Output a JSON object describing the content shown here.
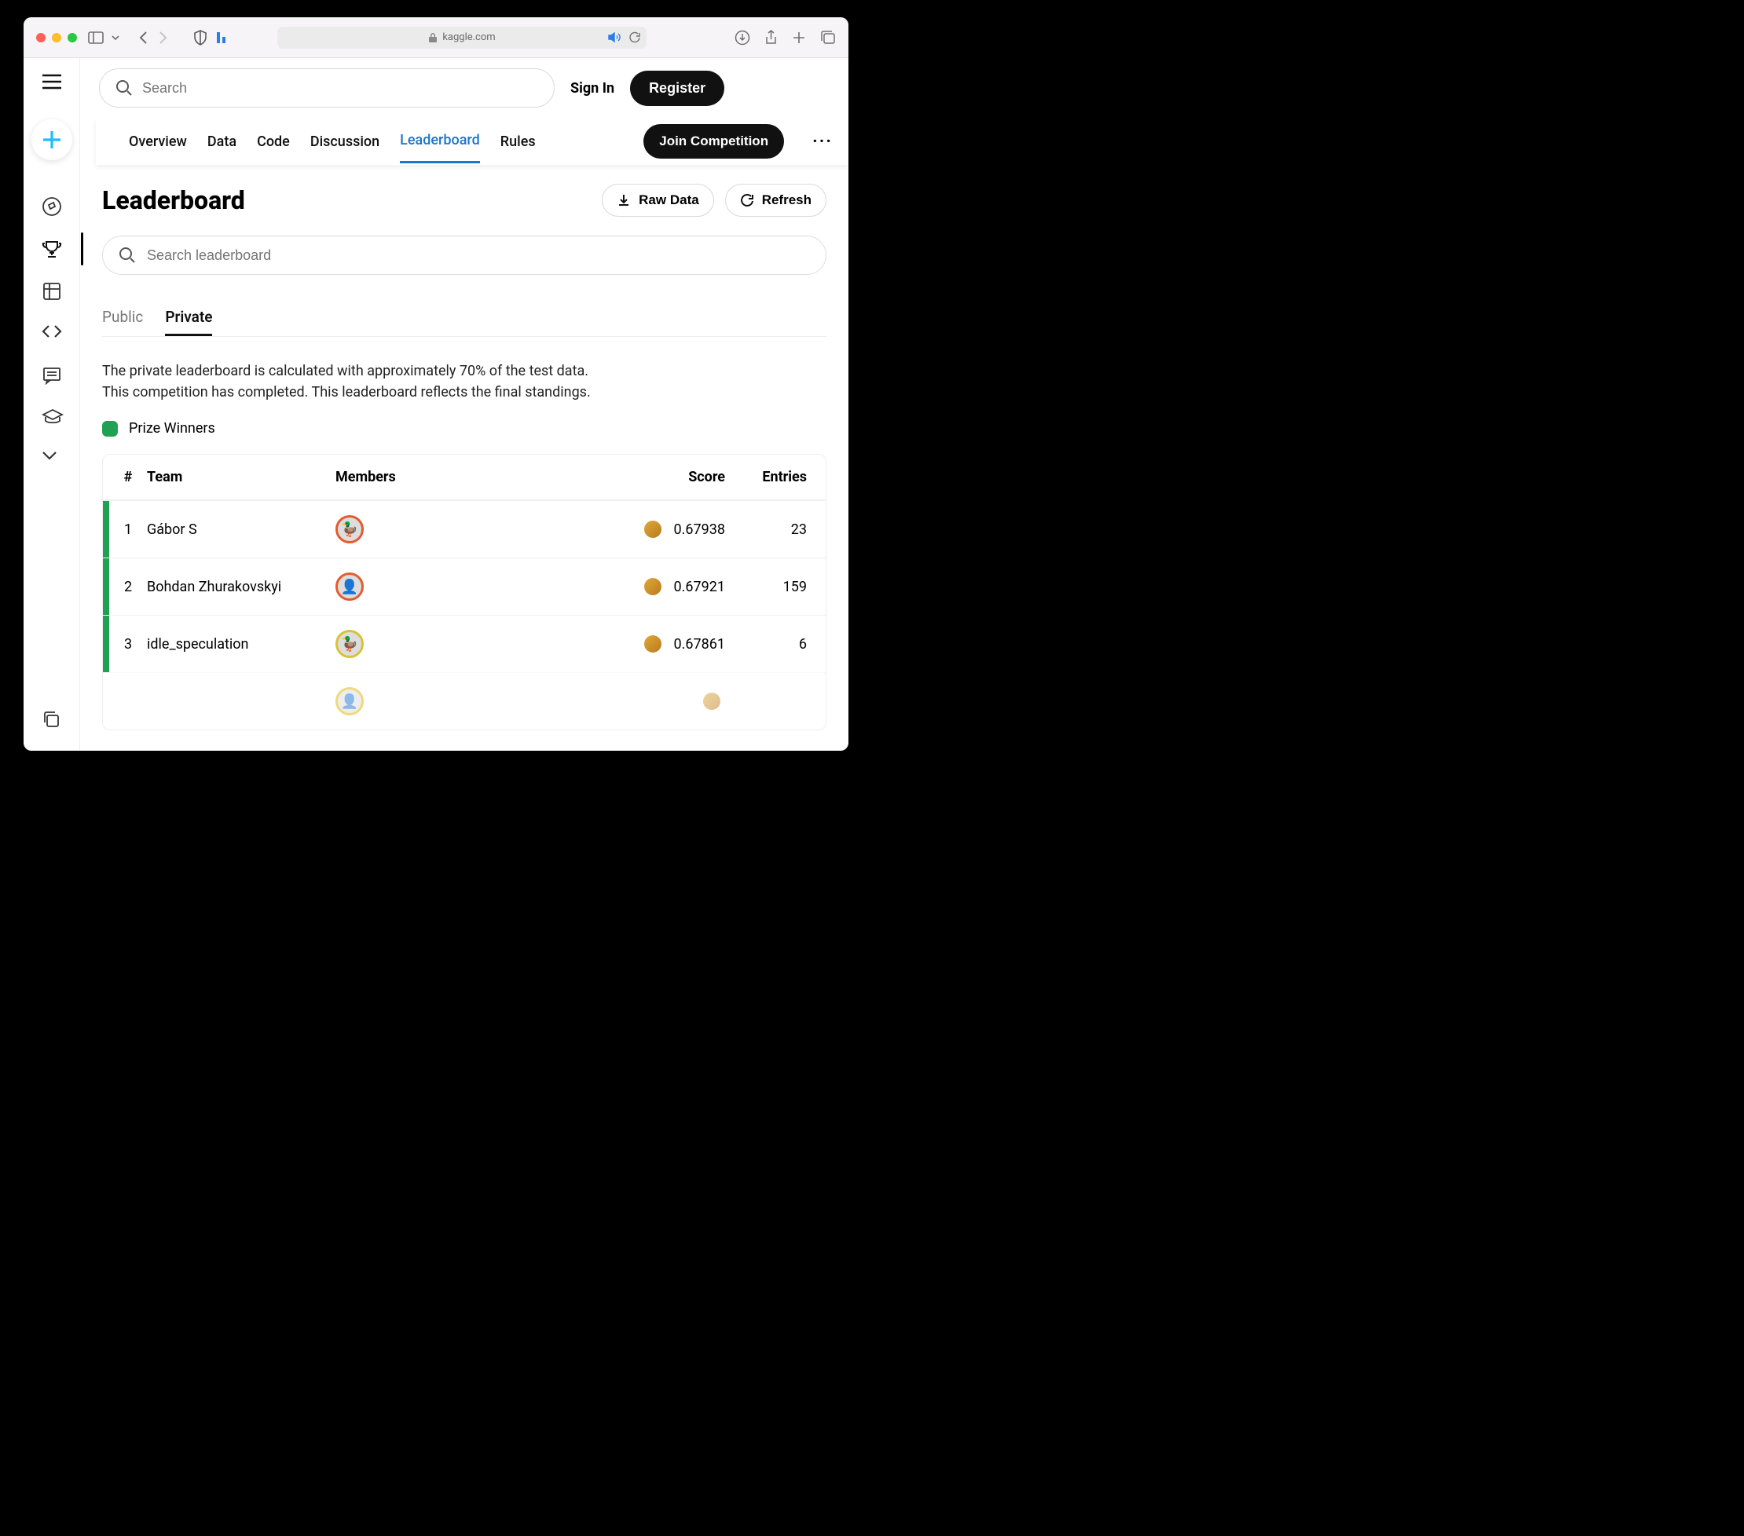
{
  "browser": {
    "domain": "kaggle.com"
  },
  "header": {
    "search_placeholder": "Search",
    "sign_in": "Sign In",
    "register": "Register"
  },
  "tabs": {
    "items": [
      "Overview",
      "Data",
      "Code",
      "Discussion",
      "Leaderboard",
      "Rules"
    ],
    "active_index": 4,
    "join_label": "Join Competition"
  },
  "page": {
    "title": "Leaderboard",
    "raw_data": "Raw Data",
    "refresh": "Refresh",
    "lb_search_placeholder": "Search leaderboard"
  },
  "subtabs": {
    "items": [
      "Public",
      "Private"
    ],
    "active_index": 1
  },
  "description": {
    "line1": "The private leaderboard is calculated with approximately 70% of the test data.",
    "line2": "This competition has completed. This leaderboard reflects the final standings."
  },
  "legend": {
    "prize_winners": "Prize Winners"
  },
  "table": {
    "columns": {
      "rank": "#",
      "team": "Team",
      "members": "Members",
      "score": "Score",
      "entries": "Entries"
    },
    "rows": [
      {
        "rank": "1",
        "team": "Gábor S",
        "score": "0.67938",
        "entries": "23",
        "prize": true,
        "avatar_border": "b1"
      },
      {
        "rank": "2",
        "team": "Bohdan Zhurakovskyi",
        "score": "0.67921",
        "entries": "159",
        "prize": true,
        "avatar_border": "b1"
      },
      {
        "rank": "3",
        "team": "idle_speculation",
        "score": "0.67861",
        "entries": "6",
        "prize": true,
        "avatar_border": "b2"
      }
    ]
  }
}
